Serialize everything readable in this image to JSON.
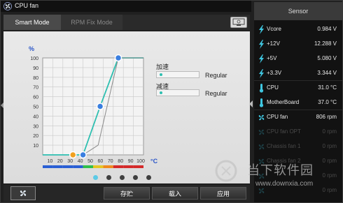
{
  "window": {
    "title": "CPU fan"
  },
  "tabs": [
    {
      "label": "Smart Mode"
    },
    {
      "label": "RPM Fix Mode"
    }
  ],
  "chart": {
    "y_unit": "%",
    "x_unit": "°C",
    "y_ticks": [
      "100",
      "90",
      "80",
      "70",
      "60",
      "50",
      "40",
      "30",
      "20",
      "10"
    ],
    "x_ticks": [
      "10",
      "20",
      "30",
      "40",
      "50",
      "60",
      "70",
      "80",
      "90",
      "100"
    ],
    "temp_zone_colors": [
      "#2a5fd4",
      "#2a5fd4",
      "#2a5fd4",
      "#2a5fd4",
      "#2fbf4a",
      "#e6c623",
      "#f08a1e",
      "#d42a2a",
      "#d42a2a",
      "#d42a2a"
    ]
  },
  "chart_data": {
    "type": "line",
    "xlabel": "°C",
    "ylabel": "%",
    "xlim": [
      0,
      100
    ],
    "ylim": [
      0,
      100
    ],
    "series": [
      {
        "role": "fan-curve",
        "color": "#2dbfb0",
        "x": [
          0,
          30,
          40,
          57,
          75,
          100
        ],
        "y": [
          0,
          0,
          0,
          50,
          100,
          100
        ]
      },
      {
        "role": "reference-curve",
        "color": "#8a8a8a",
        "x": [
          40,
          55,
          75,
          100
        ],
        "y": [
          0,
          10,
          100,
          100
        ]
      }
    ],
    "points": [
      {
        "x": 30,
        "y": 0,
        "color": "#f0a020"
      },
      {
        "x": 40,
        "y": 0,
        "color": "#3a7fe0"
      },
      {
        "x": 57,
        "y": 50,
        "color": "#3a7fe0"
      },
      {
        "x": 75,
        "y": 100,
        "color": "#3a7fe0"
      }
    ]
  },
  "speed": {
    "up_label": "加速",
    "up_value": "Regular",
    "down_label": "减速",
    "down_value": "Regular"
  },
  "pager": {
    "count": 5,
    "active": 0
  },
  "bottom": {
    "buttons": [
      {
        "label": "存贮"
      },
      {
        "label": "载入"
      },
      {
        "label": "应用"
      }
    ]
  },
  "sensor": {
    "title": "Sensor",
    "rows": [
      {
        "name": "Vcore",
        "value": "0.984  V",
        "icon": "lightning-icon",
        "color": "#3fc6e0",
        "dim": false
      },
      {
        "name": "+12V",
        "value": "12.288  V",
        "icon": "lightning-icon",
        "color": "#3fc6e0",
        "dim": false
      },
      {
        "name": "+5V",
        "value": "5.080  V",
        "icon": "lightning-icon",
        "color": "#3fc6e0",
        "dim": false
      },
      {
        "name": "+3.3V",
        "value": "3.344  V",
        "icon": "lightning-icon",
        "color": "#3fc6e0",
        "dim": false
      },
      {
        "name": "CPU",
        "value": "31.0 °C",
        "icon": "thermometer-icon",
        "color": "#3fc6e0",
        "dim": false
      },
      {
        "name": "MotherBoard",
        "value": "37.0 °C",
        "icon": "thermometer-icon",
        "color": "#3fc6e0",
        "dim": false
      },
      {
        "name": "CPU fan",
        "value": "806  rpm",
        "icon": "fan-icon",
        "color": "#3fc6e0",
        "dim": false
      },
      {
        "name": "CPU fan OPT",
        "value": "0  rpm",
        "icon": "fan-icon",
        "color": "#3fc6e0",
        "dim": true
      },
      {
        "name": "Chassis fan 1",
        "value": "0  rpm",
        "icon": "fan-icon",
        "color": "#3fc6e0",
        "dim": true
      },
      {
        "name": "Chassis fan 2",
        "value": "0  rpm",
        "icon": "fan-icon",
        "color": "#3fc6e0",
        "dim": true
      },
      {
        "name": "",
        "value": "0  rpm",
        "icon": "fan-icon",
        "color": "#3fc6e0",
        "dim": true
      },
      {
        "name": "",
        "value": "0  rpm",
        "icon": "fan-icon",
        "color": "#3fc6e0",
        "dim": true
      }
    ]
  },
  "watermark": {
    "text": "当下软件园",
    "url": "www.downxia.com"
  }
}
